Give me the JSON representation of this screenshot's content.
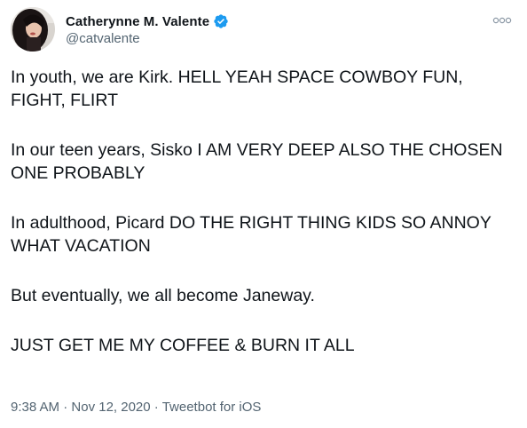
{
  "tweet": {
    "author": {
      "display_name": "Catherynne M. Valente",
      "handle": "@catvalente",
      "verified": true
    },
    "paragraphs": [
      "In youth, we are Kirk. HELL YEAH SPACE COWBOY FUN, FIGHT, FLIRT",
      "In our teen years, Sisko I AM VERY DEEP ALSO THE CHOSEN ONE PROBABLY",
      "In adulthood, Picard DO THE RIGHT THING KIDS SO ANNOY WHAT VACATION",
      "But eventually, we all become Janeway.",
      "JUST GET ME MY COFFEE & BURN IT ALL"
    ],
    "meta": {
      "time": "9:38 AM",
      "separator": "·",
      "date": "Nov 12, 2020",
      "source": "Tweetbot for iOS"
    }
  },
  "colors": {
    "verified": "#1d9bf0",
    "secondary_text": "#536471",
    "primary_text": "#0f1419"
  },
  "icons": {
    "verified": "verified-badge-icon",
    "more": "more-options-icon"
  }
}
